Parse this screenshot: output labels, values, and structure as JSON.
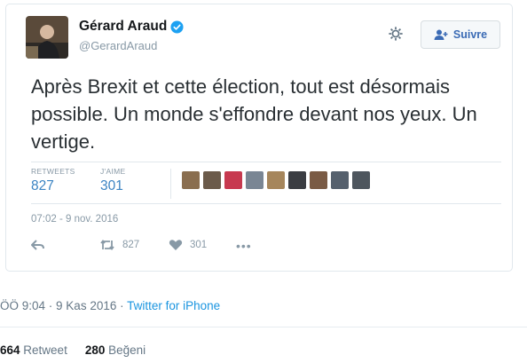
{
  "tweet": {
    "author_name": "Gérard Araud",
    "author_handle": "@GerardAraud",
    "follow_label": "Suivre",
    "text": "Après Brexit et cette élection, tout est désormais possible. Un monde s'effondre devant nos yeux. Un vertige.",
    "retweets_label": "RETWEETS",
    "retweets_count": "827",
    "likes_label": "J'AIME",
    "likes_count": "301",
    "timestamp": "07:02 - 9 nov. 2016",
    "action_retweet_count": "827",
    "action_like_count": "301",
    "liker_colors": [
      "#8a6e4f",
      "#6b5a4a",
      "#c7394f",
      "#7a8694",
      "#a6865c",
      "#3b3d42",
      "#7a5b45",
      "#55606d",
      "#4e565e"
    ]
  },
  "meta": {
    "time": "ÖÖ 9:04",
    "date": "9 Kas 2016",
    "source": "Twitter for iPhone"
  },
  "counts": {
    "retweet_num": "664",
    "retweet_label": "Retweet",
    "like_num": "280",
    "like_label": "Beğeni"
  }
}
